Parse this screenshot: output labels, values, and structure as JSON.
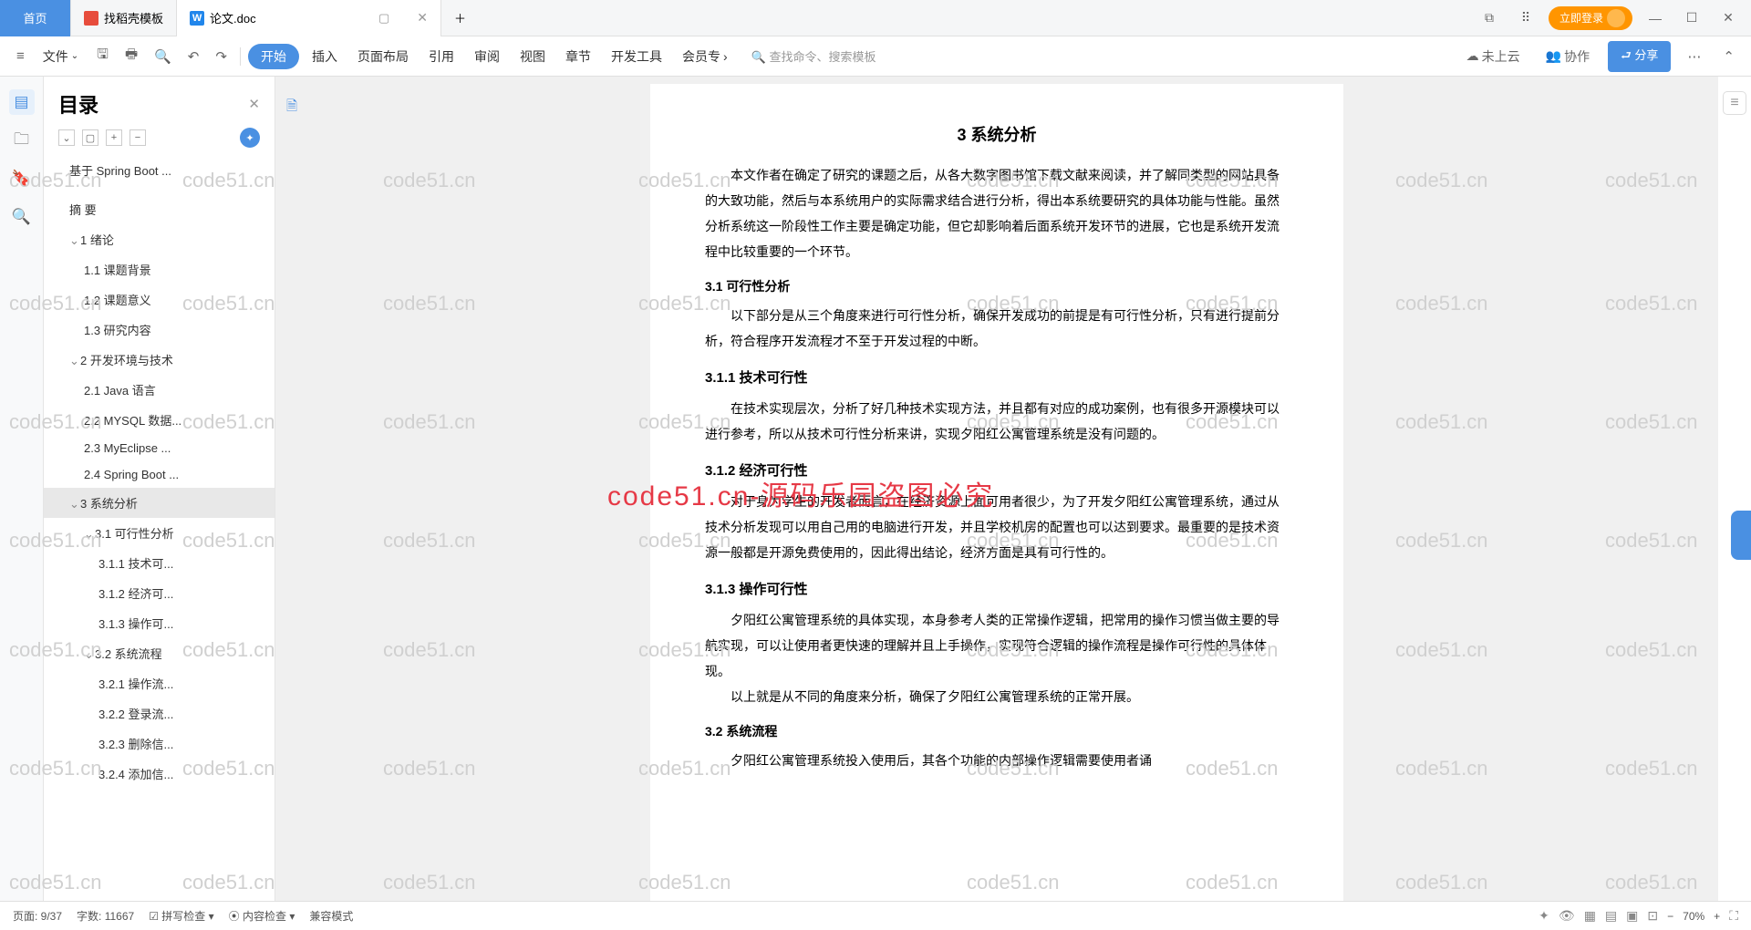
{
  "titlebar": {
    "home": "首页",
    "tab1": "找稻壳模板",
    "tab2": "论文.doc",
    "login": "立即登录"
  },
  "toolbar": {
    "file": "文件",
    "start": "开始",
    "insert": "插入",
    "layout": "页面布局",
    "ref": "引用",
    "review": "审阅",
    "view": "视图",
    "chapter": "章节",
    "devtools": "开发工具",
    "member": "会员专",
    "search": "查找命令、搜索模板",
    "cloud": "未上云",
    "coop": "协作",
    "share": "分享"
  },
  "outline": {
    "title": "目录",
    "doc_title": "基于 Spring Boot ...",
    "items": [
      {
        "txt": "摘  要",
        "lvl": 1,
        "caret": ""
      },
      {
        "txt": "1  绪论",
        "lvl": 1,
        "caret": "⌄"
      },
      {
        "txt": "1.1  课题背景",
        "lvl": 2
      },
      {
        "txt": "1.2  课题意义",
        "lvl": 2
      },
      {
        "txt": "1.3  研究内容",
        "lvl": 2
      },
      {
        "txt": "2  开发环境与技术",
        "lvl": 1,
        "caret": "⌄"
      },
      {
        "txt": "2.1 Java 语言",
        "lvl": 2
      },
      {
        "txt": "2.2 MYSQL 数据...",
        "lvl": 2
      },
      {
        "txt": "2.3 MyEclipse ...",
        "lvl": 2
      },
      {
        "txt": "2.4 Spring Boot ...",
        "lvl": 2
      },
      {
        "txt": "3  系统分析",
        "lvl": 1,
        "caret": "⌄",
        "sel": true
      },
      {
        "txt": "3.1  可行性分析",
        "lvl": 2,
        "caret": "⌄"
      },
      {
        "txt": "3.1.1  技术可...",
        "lvl": 3
      },
      {
        "txt": "3.1.2  经济可...",
        "lvl": 3
      },
      {
        "txt": "3.1.3  操作可...",
        "lvl": 3
      },
      {
        "txt": "3.2  系统流程",
        "lvl": 2,
        "caret": "⌄"
      },
      {
        "txt": "3.2.1  操作流...",
        "lvl": 3
      },
      {
        "txt": "3.2.2  登录流...",
        "lvl": 3
      },
      {
        "txt": "3.2.3  删除信...",
        "lvl": 3
      },
      {
        "txt": "3.2.4  添加信...",
        "lvl": 3
      }
    ]
  },
  "document": {
    "h_ch3": "3  系统分析",
    "p_intro": "本文作者在确定了研究的课题之后，从各大数字图书馆下载文献来阅读，并了解同类型的网站具备的大致功能，然后与本系统用户的实际需求结合进行分析，得出本系统要研究的具体功能与性能。虽然分析系统这一阶段性工作主要是确定功能，但它却影响着后面系统开发环节的进展，它也是系统开发流程中比较重要的一个环节。",
    "h_31": "3.1  可行性分析",
    "p_31": "以下部分是从三个角度来进行可行性分析，确保开发成功的前提是有可行性分析，只有进行提前分析，符合程序开发流程才不至于开发过程的中断。",
    "h_311": "3.1.1  技术可行性",
    "p_311": "在技术实现层次，分析了好几种技术实现方法，并且都有对应的成功案例，也有很多开源模块可以进行参考，所以从技术可行性分析来讲，实现夕阳红公寓管理系统是没有问题的。",
    "h_312": "3.1.2  经济可行性",
    "p_312": "对于身为学生的开发者而言，在经济资源上面可用者很少，为了开发夕阳红公寓管理系统，通过从技术分析发现可以用自己用的电脑进行开发，并且学校机房的配置也可以达到要求。最重要的是技术资源一般都是开源免费使用的，因此得出结论，经济方面是具有可行性的。",
    "h_313": "3.1.3  操作可行性",
    "p_313": "夕阳红公寓管理系统的具体实现，本身参考人类的正常操作逻辑，把常用的操作习惯当做主要的导航实现，可以让使用者更快速的理解并且上手操作，实现符合逻辑的操作流程是操作可行性的具体体现。",
    "p_313b": "以上就是从不同的角度来分析，确保了夕阳红公寓管理系统的正常开展。",
    "h_32": "3.2  系统流程",
    "p_32": "夕阳红公寓管理系统投入使用后，其各个功能的内部操作逻辑需要使用者诵"
  },
  "statusbar": {
    "page": "页面: 9/37",
    "words": "字数: 11667",
    "spell": "拼写检查",
    "content": "内容检查",
    "compat": "兼容模式",
    "zoom": "70%"
  },
  "watermark": "code51.cn",
  "wm_red": "code51.cn-源码乐园盗图必究"
}
